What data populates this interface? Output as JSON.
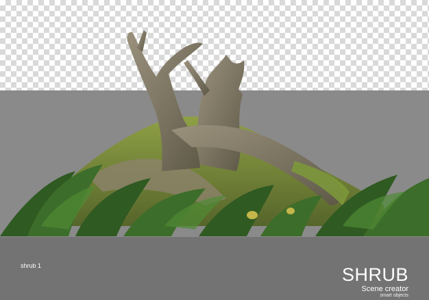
{
  "scene": {
    "subject": "shrub-with-dead-tree-stump",
    "background_colors": {
      "checker_light": "#ffffff",
      "checker_dark": "#d9d9d9",
      "mid_gray": "#8a8a8a",
      "bottom_gray": "#737373"
    }
  },
  "caption": {
    "label": "shrub 1"
  },
  "brand": {
    "title": "SHRUB",
    "subtitle": "Scene creator",
    "tagline": "smart objects"
  }
}
